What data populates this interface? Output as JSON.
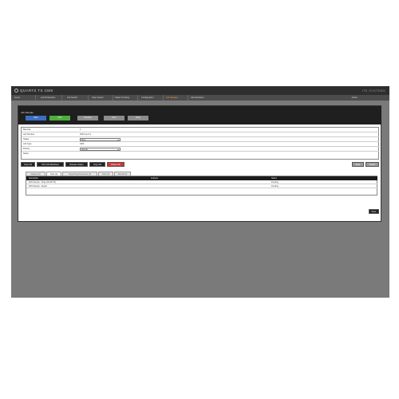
{
  "app": {
    "brand": "QUARTZ TS CMS",
    "brand_right": "ITE SYSTEMS"
  },
  "nav": {
    "items": [
      {
        "label": "Home",
        "active": false
      },
      {
        "label": "Lab Workorders",
        "active": false
      },
      {
        "label": "Job Search",
        "active": false
      },
      {
        "label": "Case Viewer",
        "active": false
      },
      {
        "label": "Status Tracking",
        "active": false
      },
      {
        "label": "Configuration",
        "active": false
      },
      {
        "label": "Job Samples",
        "active": true
      },
      {
        "label": "Administration",
        "active": false
      }
    ],
    "user": "Admin"
  },
  "card": {
    "title": "Job Sample",
    "top_buttons": [
      {
        "label": "Save",
        "color": "#3a6fc4"
      },
      {
        "label": "Print",
        "color": "#4caf3c"
      },
      {
        "label": "Previous",
        "color": "#8c8c8c"
      },
      {
        "label": "Next",
        "color": "#8c8c8c"
      },
      {
        "label": "Close",
        "color": "#8c8c8c"
      }
    ]
  },
  "form": {
    "rows": [
      {
        "label": "Barcode",
        "value": "1"
      },
      {
        "label": "Job Number",
        "value": "2013-xxx7-1"
      },
      {
        "label": "Status",
        "select": "Prep"
      },
      {
        "label": "Job Type",
        "value": "SDS"
      },
      {
        "label": "Priority",
        "select": "Normal"
      },
      {
        "label": "Notes",
        "value": ""
      }
    ]
  },
  "actions": {
    "left": [
      {
        "label": "Copy Job",
        "color": "#222222"
      },
      {
        "label": "Print Job Worksheet",
        "color": "#222222"
      },
      {
        "label": "Release Copies",
        "color": "#222222"
      },
      {
        "label": "Copy Job",
        "color": "#222222"
      },
      {
        "label": "Delete Job",
        "color": "#d33333"
      }
    ],
    "right": [
      {
        "label": "Save",
        "color": "#9a9a9a"
      },
      {
        "label": "Cancel",
        "color": "#9a9a9a"
      }
    ]
  },
  "tabs": [
    {
      "label": "Analysis (2)",
      "active": false
    },
    {
      "label": "Tests (2)",
      "active": true
    },
    {
      "label": "Supporting Documents (0)",
      "active": false
    },
    {
      "label": "Tests (0)",
      "active": false
    },
    {
      "label": "Results (0)",
      "active": false
    }
  ],
  "table": {
    "headers": [
      "Description",
      "Analysis",
      "Status"
    ],
    "rows": [
      [
        "SDS Sample - Wrap (00-00778)",
        "",
        "Pending"
      ],
      [
        "SDS Sample - Report",
        "",
        "Pending"
      ]
    ]
  },
  "bottom_button": {
    "label": "Done"
  }
}
